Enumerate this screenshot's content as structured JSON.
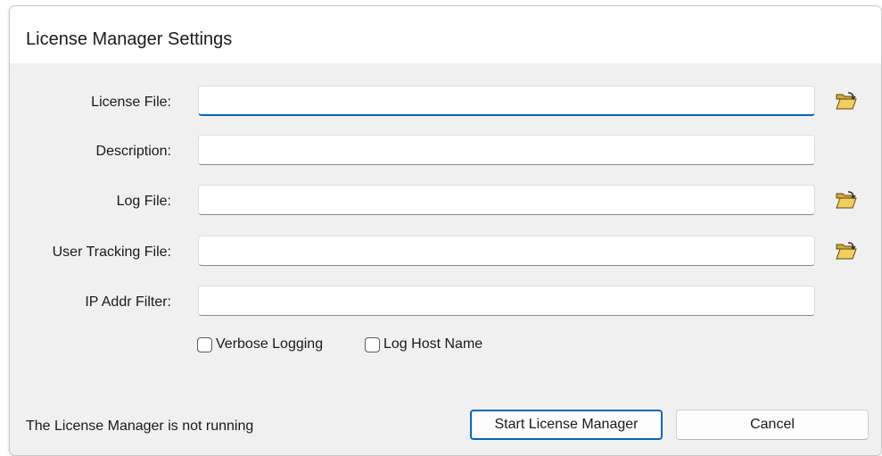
{
  "window": {
    "title": "License Manager Settings"
  },
  "fields": [
    {
      "label": "License File:",
      "value": "",
      "has_browse": true,
      "focused": true
    },
    {
      "label": "Description:",
      "value": "",
      "has_browse": false,
      "focused": false
    },
    {
      "label": "Log File:",
      "value": "",
      "has_browse": true,
      "focused": false
    },
    {
      "label": "User Tracking File:",
      "value": "",
      "has_browse": true,
      "focused": false
    },
    {
      "label": "IP Addr Filter:",
      "value": "",
      "has_browse": false,
      "focused": false
    }
  ],
  "options": {
    "verbose_logging": {
      "label": "Verbose Logging",
      "checked": false
    },
    "log_host_name": {
      "label": "Log Host Name",
      "checked": false
    }
  },
  "status": {
    "text": "The License Manager is not running"
  },
  "buttons": {
    "start": "Start License Manager",
    "cancel": "Cancel"
  },
  "icons": {
    "browse": "folder-open-icon"
  },
  "colors": {
    "accent": "#0067c0",
    "folder": "#e8c14a"
  }
}
